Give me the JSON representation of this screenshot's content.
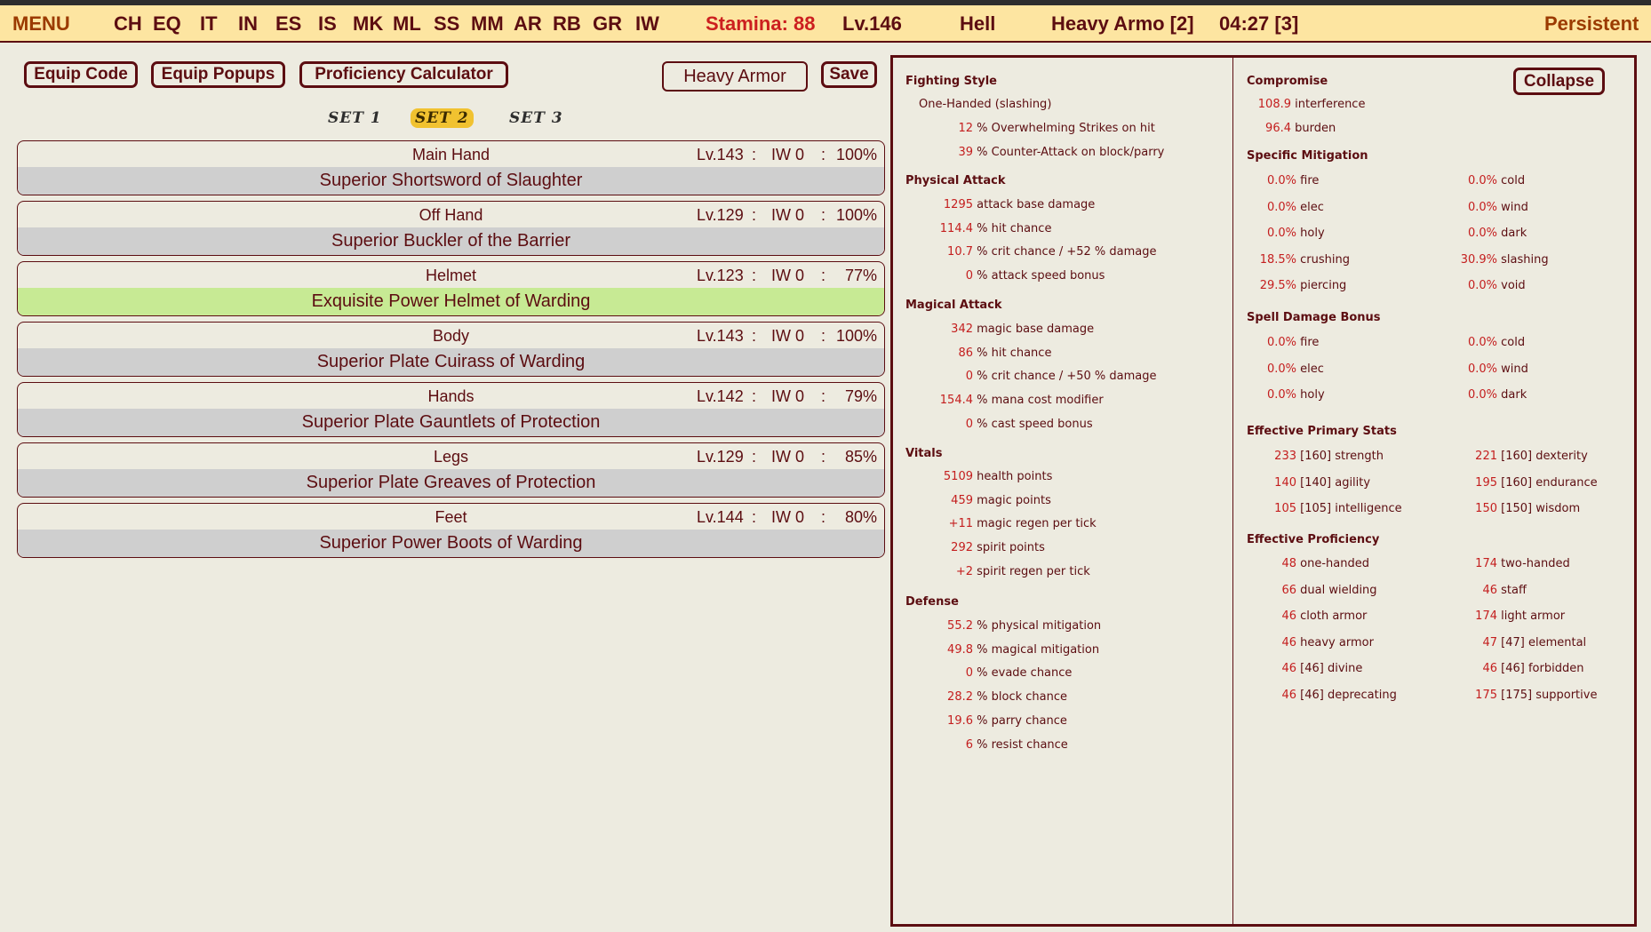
{
  "topbar": {
    "menu": "MENU",
    "nav": [
      "CH",
      "EQ",
      "IT",
      "IN",
      "ES",
      "IS",
      "MK",
      "ML",
      "SS",
      "MM",
      "AR",
      "RB",
      "GR",
      "IW"
    ],
    "stamina": "Stamina: 88",
    "level": "Lv.146",
    "difficulty": "Hell",
    "persona": "Heavy Armo [2]",
    "time": "04:27 [3]",
    "mode": "Persistent"
  },
  "toolbar": {
    "equip_code": "Equip Code",
    "equip_popups": "Equip Popups",
    "proficiency_calc": "Proficiency Calculator",
    "profile_value": "Heavy Armor",
    "save": "Save"
  },
  "sets": [
    "SET 1",
    "SET 2",
    "SET 3"
  ],
  "active_set": "SET 2",
  "slots": [
    {
      "name": "Main Hand",
      "lv": "Lv.143",
      "iw": "IW 0",
      "pct": "100%",
      "item": "Superior Shortsword of Slaughter",
      "highlight": false
    },
    {
      "name": "Off Hand",
      "lv": "Lv.129",
      "iw": "IW 0",
      "pct": "100%",
      "item": "Superior Buckler of the Barrier",
      "highlight": false
    },
    {
      "name": "Helmet",
      "lv": "Lv.123",
      "iw": "IW 0",
      "pct": "77%",
      "item": "Exquisite Power Helmet of Warding",
      "highlight": true
    },
    {
      "name": "Body",
      "lv": "Lv.143",
      "iw": "IW 0",
      "pct": "100%",
      "item": "Superior Plate Cuirass of Warding",
      "highlight": false
    },
    {
      "name": "Hands",
      "lv": "Lv.142",
      "iw": "IW 0",
      "pct": "79%",
      "item": "Superior Plate Gauntlets of Protection",
      "highlight": false
    },
    {
      "name": "Legs",
      "lv": "Lv.129",
      "iw": "IW 0",
      "pct": "85%",
      "item": "Superior Plate Greaves of Protection",
      "highlight": false
    },
    {
      "name": "Feet",
      "lv": "Lv.144",
      "iw": "IW 0",
      "pct": "80%",
      "item": "Superior Power Boots of Warding",
      "highlight": false
    }
  ],
  "stats": {
    "collapse": "Collapse",
    "fighting_style": {
      "title": "Fighting Style",
      "style": "One-Handed (slashing)",
      "lines": [
        [
          "12",
          "% Overwhelming Strikes on hit"
        ],
        [
          "39",
          "% Counter-Attack on block/parry"
        ]
      ]
    },
    "physical": {
      "title": "Physical Attack",
      "lines": [
        [
          "1295",
          "attack base damage"
        ],
        [
          "114.4",
          "% hit chance"
        ],
        [
          "10.7",
          "% crit chance / +52 % damage"
        ],
        [
          "0",
          "% attack speed bonus"
        ]
      ]
    },
    "magical": {
      "title": "Magical Attack",
      "lines": [
        [
          "342",
          "magic base damage"
        ],
        [
          "86",
          "% hit chance"
        ],
        [
          "0",
          "% crit chance / +50 % damage"
        ],
        [
          "154.4",
          "% mana cost modifier"
        ],
        [
          "0",
          "% cast speed bonus"
        ]
      ]
    },
    "vitals": {
      "title": "Vitals",
      "lines": [
        [
          "5109",
          "health points"
        ],
        [
          "459",
          "magic points"
        ],
        [
          "+11",
          "magic regen per tick"
        ],
        [
          "292",
          "spirit points"
        ],
        [
          "+2",
          "spirit regen per tick"
        ]
      ]
    },
    "defense": {
      "title": "Defense",
      "lines": [
        [
          "55.2",
          "% physical mitigation"
        ],
        [
          "49.8",
          "% magical mitigation"
        ],
        [
          "0",
          "% evade chance"
        ],
        [
          "28.2",
          "% block chance"
        ],
        [
          "19.6",
          "% parry chance"
        ],
        [
          "6",
          "% resist chance"
        ]
      ]
    },
    "compromise": {
      "title": "Compromise",
      "lines": [
        [
          "108.9",
          "interference"
        ],
        [
          "96.4",
          "burden"
        ]
      ]
    },
    "specific_mitigation": {
      "title": "Specific Mitigation",
      "left": [
        [
          "0.0%",
          "fire"
        ],
        [
          "0.0%",
          "elec"
        ],
        [
          "0.0%",
          "holy"
        ],
        [
          "18.5%",
          "crushing"
        ],
        [
          "29.5%",
          "piercing"
        ]
      ],
      "right": [
        [
          "0.0%",
          "cold"
        ],
        [
          "0.0%",
          "wind"
        ],
        [
          "0.0%",
          "dark"
        ],
        [
          "30.9%",
          "slashing"
        ],
        [
          "0.0%",
          "void"
        ]
      ]
    },
    "spell_damage": {
      "title": "Spell Damage Bonus",
      "left": [
        [
          "0.0%",
          "fire"
        ],
        [
          "0.0%",
          "elec"
        ],
        [
          "0.0%",
          "holy"
        ]
      ],
      "right": [
        [
          "0.0%",
          "cold"
        ],
        [
          "0.0%",
          "wind"
        ],
        [
          "0.0%",
          "dark"
        ]
      ]
    },
    "primary": {
      "title": "Effective Primary Stats",
      "left": [
        [
          "233",
          "[160] strength"
        ],
        [
          "140",
          "[140] agility"
        ],
        [
          "105",
          "[105] intelligence"
        ]
      ],
      "right": [
        [
          "221",
          "[160] dexterity"
        ],
        [
          "195",
          "[160] endurance"
        ],
        [
          "150",
          "[150] wisdom"
        ]
      ]
    },
    "proficiency": {
      "title": "Effective Proficiency",
      "left": [
        [
          "48",
          "one-handed"
        ],
        [
          "66",
          "dual wielding"
        ],
        [
          "46",
          "cloth armor"
        ],
        [
          "46",
          "heavy armor"
        ],
        [
          "46",
          "[46] divine"
        ],
        [
          "46",
          "[46] deprecating"
        ]
      ],
      "right": [
        [
          "174",
          "two-handed"
        ],
        [
          "46",
          "staff"
        ],
        [
          "174",
          "light armor"
        ],
        [
          "47",
          "[47] elemental"
        ],
        [
          "46",
          "[46] forbidden"
        ],
        [
          "175",
          "[175] supportive"
        ]
      ]
    }
  }
}
